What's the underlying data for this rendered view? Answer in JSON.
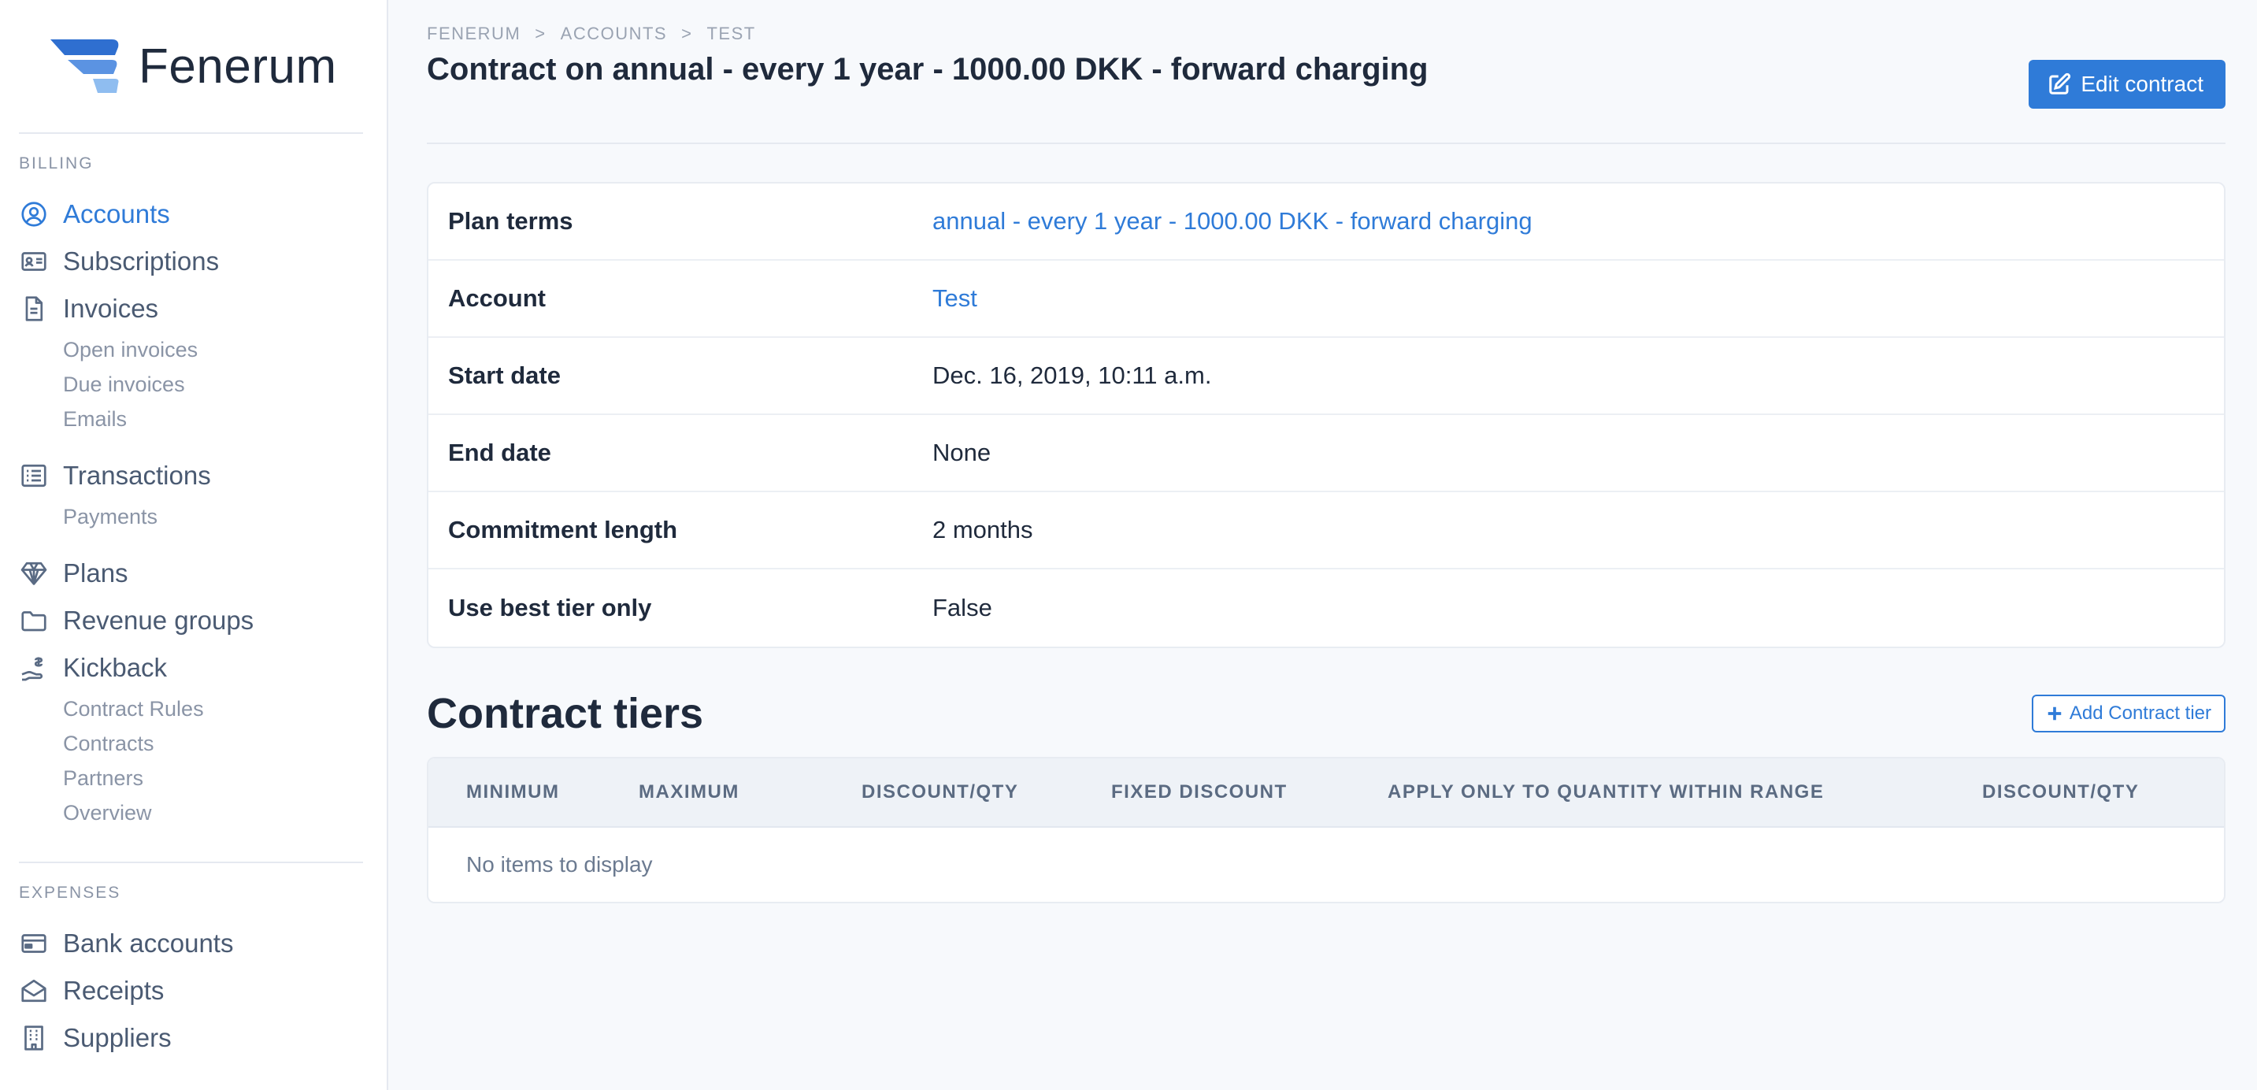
{
  "brand": {
    "name": "Fenerum",
    "colors": {
      "accent": "#2f7bd8",
      "logo_dark": "#2f6fd0",
      "logo_light": "#7fb2ee"
    }
  },
  "sidebar": {
    "billing_label": "BILLING",
    "billing_items": [
      {
        "label": "Accounts",
        "icon": "user-circle-icon",
        "active": true,
        "subs": []
      },
      {
        "label": "Subscriptions",
        "icon": "id-card-icon",
        "active": false,
        "subs": []
      },
      {
        "label": "Invoices",
        "icon": "document-icon",
        "active": false,
        "subs": [
          "Open invoices",
          "Due invoices",
          "Emails"
        ]
      },
      {
        "label": "Transactions",
        "icon": "list-icon",
        "active": false,
        "subs": [
          "Payments"
        ]
      },
      {
        "label": "Plans",
        "icon": "diamond-icon",
        "active": false,
        "subs": []
      },
      {
        "label": "Revenue groups",
        "icon": "folder-icon",
        "active": false,
        "subs": []
      },
      {
        "label": "Kickback",
        "icon": "hand-coin-icon",
        "active": false,
        "subs": [
          "Contract Rules",
          "Contracts",
          "Partners",
          "Overview"
        ]
      }
    ],
    "expenses_label": "EXPENSES",
    "expense_items": [
      {
        "label": "Bank accounts",
        "icon": "credit-card-icon"
      },
      {
        "label": "Receipts",
        "icon": "envelope-open-icon"
      },
      {
        "label": "Suppliers",
        "icon": "building-icon"
      }
    ]
  },
  "breadcrumb": [
    "FENERUM",
    ">",
    "ACCOUNTS",
    ">",
    "TEST"
  ],
  "page_title": "Contract on annual - every 1 year - 1000.00 DKK - forward charging",
  "edit_button": "Edit contract",
  "details": [
    {
      "key": "Plan terms",
      "value": "annual - every 1 year - 1000.00 DKK - forward charging",
      "link": true
    },
    {
      "key": "Account",
      "value": "Test",
      "link": true
    },
    {
      "key": "Start date",
      "value": "Dec. 16, 2019, 10:11 a.m.",
      "link": false
    },
    {
      "key": "End date",
      "value": "None",
      "link": false
    },
    {
      "key": "Commitment length",
      "value": "2 months",
      "link": false
    },
    {
      "key": "Use best tier only",
      "value": "False",
      "link": false
    }
  ],
  "tiers": {
    "title": "Contract tiers",
    "add_button": "Add Contract tier",
    "columns": [
      "MINIMUM",
      "MAXIMUM",
      "DISCOUNT/QTY",
      "FIXED DISCOUNT",
      "APPLY ONLY TO QUANTITY WITHIN RANGE",
      "DISCOUNT/QTY"
    ],
    "empty_text": "No items to display"
  }
}
